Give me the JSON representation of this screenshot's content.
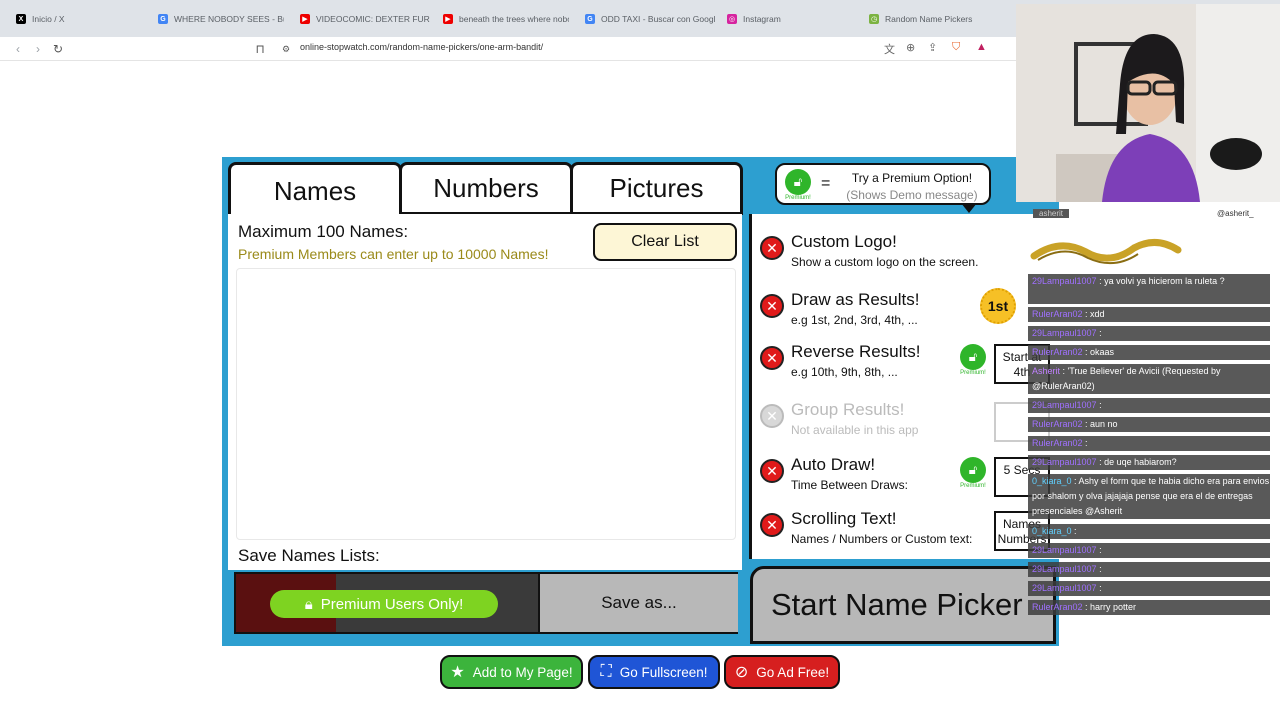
{
  "browser": {
    "tabs": [
      {
        "label": "Inicio / X",
        "icon": "x-logo-icon"
      },
      {
        "label": "WHERE NOBODY SEES - Busca",
        "icon": "google-icon"
      },
      {
        "label": "VIDEOCOMIC: DEXTER FURRA",
        "icon": "youtube-icon"
      },
      {
        "label": "beneath the trees where nobo",
        "icon": "youtube-icon"
      },
      {
        "label": "ODD TAXI - Buscar con Google",
        "icon": "google-icon"
      },
      {
        "label": "Instagram",
        "icon": "instagram-icon"
      },
      {
        "label": "Random Name Pickers",
        "icon": "stopwatch-icon"
      }
    ],
    "url": "online-stopwatch.com/random-name-pickers/one-arm-bandit/"
  },
  "app": {
    "tabs": [
      "Names",
      "Numbers",
      "Pictures"
    ],
    "premium_callout": {
      "equals": "=",
      "line1": "Try a Premium Option!",
      "line2": "(Shows Demo message)",
      "lock_label": "Premium!"
    },
    "max_names": "Maximum 100 Names:",
    "premium_note": "Premium Members can enter  up to 10000 Names!",
    "clear_list": "Clear List",
    "save_title": "Save Names Lists:",
    "premium_users_only": "Premium Users Only!",
    "save_as": "Save as...",
    "start_button": "Start Name Picker",
    "options": [
      {
        "title": "Custom Logo!",
        "desc": "Show a custom logo on the screen."
      },
      {
        "title": "Draw as Results!",
        "desc": "e.g 1st, 2nd, 3rd, 4th, ...",
        "badge": "1st"
      },
      {
        "title": "Reverse Results!",
        "desc": "e.g 10th, 9th, 8th, ...",
        "box": "Start at 4th",
        "lock_label": "Premium!"
      },
      {
        "title": "Group Results!",
        "desc": "Not available in this app"
      },
      {
        "title": "Auto Draw!",
        "desc": "Time Between Draws:",
        "box": "5 Secs",
        "lock_label": "Premium!"
      },
      {
        "title": "Scrolling Text!",
        "desc": "Names / Numbers or Custom text:",
        "box": "Names Numbers"
      }
    ]
  },
  "bottom_buttons": [
    {
      "label": "Add to My Page!",
      "color": "#3cb43c",
      "icon": "star-icon"
    },
    {
      "label": "Go Fullscreen!",
      "color": "#1f55d6",
      "icon": "fullscreen-icon"
    },
    {
      "label": "Go Ad Free!",
      "color": "#d61f1f",
      "icon": "no-ads-icon"
    }
  ],
  "stream": {
    "header_left": "asherit",
    "header_right": "@asherit_",
    "chat": [
      {
        "user": "29Lampaul1007",
        "msg": ": ya volvi ya hicierom la ruleta ?",
        "color": "#a070ff"
      },
      {
        "user": "RulerAran02",
        "msg": ": xdd",
        "color": "#a070ff"
      },
      {
        "user": "29Lampaul1007",
        "msg": ":",
        "color": "#a070ff"
      },
      {
        "user": "RulerAran02",
        "msg": ": okaas",
        "color": "#a070ff"
      },
      {
        "user": "Asherit",
        "msg": ": 'True Believer' de Avicii (Requested by @RulerAran02)",
        "color": "#c080ff"
      },
      {
        "user": "29Lampaul1007",
        "msg": ":",
        "color": "#a070ff"
      },
      {
        "user": "RulerAran02",
        "msg": ": aun no",
        "color": "#a070ff"
      },
      {
        "user": "RulerAran02",
        "msg": ":",
        "color": "#a070ff"
      },
      {
        "user": "29Lampaul1007",
        "msg": ": de uqe habiarom?",
        "color": "#a070ff"
      },
      {
        "user": "0_kiara_0",
        "msg": ": Ashy el form que te habia dicho era para envios por shalom y olva jajajaja pense que era el de entregas presenciales @Asherit",
        "color": "#60d0ff"
      },
      {
        "user": "0_kiara_0",
        "msg": ":",
        "color": "#60d0ff"
      },
      {
        "user": "29Lampaul1007",
        "msg": ":",
        "color": "#a070ff"
      },
      {
        "user": "29Lampaul1007",
        "msg": ":",
        "color": "#a070ff"
      },
      {
        "user": "29Lampaul1007",
        "msg": ":",
        "color": "#a070ff"
      },
      {
        "user": "RulerAran02",
        "msg": ": harry potter",
        "color": "#a070ff"
      }
    ]
  }
}
